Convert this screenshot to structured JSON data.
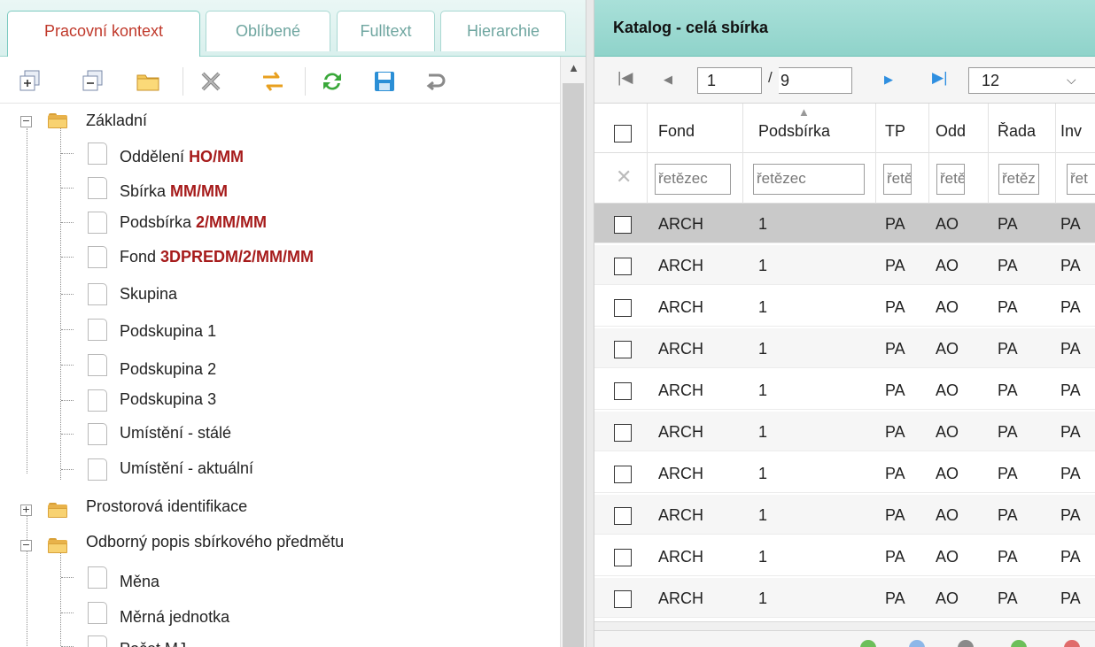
{
  "left_panel": {
    "tabs": [
      {
        "label": "Pracovní kontext",
        "active": true
      },
      {
        "label": "Oblíbené",
        "active": false
      },
      {
        "label": "Fulltext",
        "active": false
      },
      {
        "label": "Hierarchie",
        "active": false
      }
    ],
    "toolbar_icons": [
      "expand-all-icon",
      "collapse-all-icon",
      "folder-icon",
      "delete-icon",
      "swap-icon",
      "refresh-icon",
      "save-icon",
      "undo-icon"
    ],
    "tree": {
      "groups": [
        {
          "label": "Základní",
          "expanded": true,
          "items": [
            {
              "label": "Oddělení ",
              "value": "HO/MM"
            },
            {
              "label": "Sbírka ",
              "value": "MM/MM"
            },
            {
              "label": "Podsbírka ",
              "value": "2/MM/MM"
            },
            {
              "label": "Fond ",
              "value": "3DPREDM/2/MM/MM"
            },
            {
              "label": "Skupina",
              "value": ""
            },
            {
              "label": "Podskupina 1",
              "value": ""
            },
            {
              "label": "Podskupina 2",
              "value": ""
            },
            {
              "label": "Podskupina 3",
              "value": ""
            },
            {
              "label": "Umístění - stálé",
              "value": ""
            },
            {
              "label": "Umístění - aktuální",
              "value": ""
            }
          ]
        },
        {
          "label": "Prostorová identifikace",
          "expanded": false,
          "items": []
        },
        {
          "label": "Odborný popis sbírkového předmětu",
          "expanded": true,
          "items": [
            {
              "label": "Měna",
              "value": ""
            },
            {
              "label": "Měrná jednotka",
              "value": ""
            },
            {
              "label": "Počet MJ",
              "value": ""
            }
          ]
        }
      ]
    }
  },
  "right_panel": {
    "title": "Katalog - celá sbírka",
    "pager": {
      "first_icon": "first-page-icon",
      "prev_icon": "prev-page-icon",
      "current_page": "1",
      "separator": "/",
      "total_pages": "9",
      "next_icon": "next-page-icon",
      "last_icon": "last-page-icon",
      "page_size": "12",
      "dropdown_icon": "chevron-down-icon"
    },
    "grid": {
      "columns": [
        "Fond",
        "Podsbírka",
        "TP",
        "Odd",
        "Řada",
        "Inv"
      ],
      "filter_placeholders": [
        "řetězec",
        "řetězec",
        "řetě",
        "řetě",
        "řetěz",
        "řet"
      ],
      "rows": [
        [
          "ARCH",
          "1",
          "PA",
          "AO",
          "PA",
          "PA"
        ],
        [
          "ARCH",
          "1",
          "PA",
          "AO",
          "PA",
          "PA"
        ],
        [
          "ARCH",
          "1",
          "PA",
          "AO",
          "PA",
          "PA"
        ],
        [
          "ARCH",
          "1",
          "PA",
          "AO",
          "PA",
          "PA"
        ],
        [
          "ARCH",
          "1",
          "PA",
          "AO",
          "PA",
          "PA"
        ],
        [
          "ARCH",
          "1",
          "PA",
          "AO",
          "PA",
          "PA"
        ],
        [
          "ARCH",
          "1",
          "PA",
          "AO",
          "PA",
          "PA"
        ],
        [
          "ARCH",
          "1",
          "PA",
          "AO",
          "PA",
          "PA"
        ],
        [
          "ARCH",
          "1",
          "PA",
          "AO",
          "PA",
          "PA"
        ],
        [
          "ARCH",
          "1",
          "PA",
          "AO",
          "PA",
          "PA"
        ]
      ],
      "selected_row": 0
    }
  },
  "colors": {
    "accent_red": "#a61b1b",
    "header_teal": "#8fd3ca",
    "tab_active_text": "#c0392b"
  }
}
